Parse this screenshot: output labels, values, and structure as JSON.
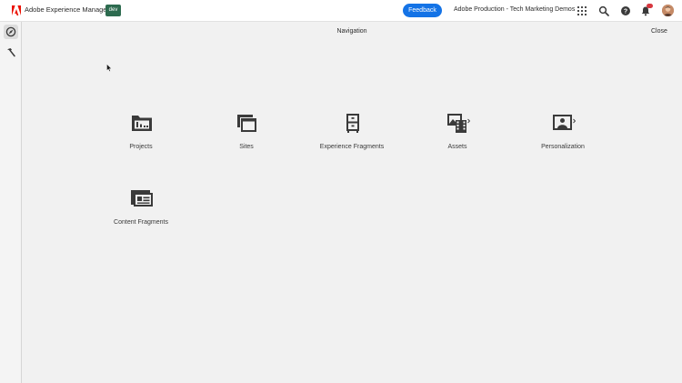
{
  "header": {
    "app_name": "Adobe Experience Manager",
    "env_badge": "dev",
    "feedback_label": "Feedback",
    "org_name": "Adobe Production - Tech Marketing Demos",
    "icons": [
      "apps-grid-icon",
      "search-icon",
      "help-icon",
      "bell-icon",
      "user-avatar"
    ],
    "notification_count": "",
    "colors": {
      "accent": "#1473e6",
      "badge": "#2d6b4f",
      "adobe_red": "#eb1000"
    }
  },
  "sidebar": {
    "items": [
      {
        "icon": "compass-icon",
        "active": true
      },
      {
        "icon": "hammer-icon",
        "active": false
      }
    ]
  },
  "panel": {
    "title": "Navigation",
    "close_label": "Close"
  },
  "nav_items": [
    {
      "label": "Projects",
      "icon": "projects-folder-icon",
      "has_submenu": false
    },
    {
      "label": "Sites",
      "icon": "sites-windows-icon",
      "has_submenu": false
    },
    {
      "label": "Experience Fragments",
      "icon": "experience-fragments-cabinet-icon",
      "has_submenu": false
    },
    {
      "label": "Assets",
      "icon": "assets-media-icon",
      "has_submenu": true
    },
    {
      "label": "Personalization",
      "icon": "personalization-screen-icon",
      "has_submenu": true
    },
    {
      "label": "Content Fragments",
      "icon": "content-fragments-icon",
      "has_submenu": false
    }
  ]
}
